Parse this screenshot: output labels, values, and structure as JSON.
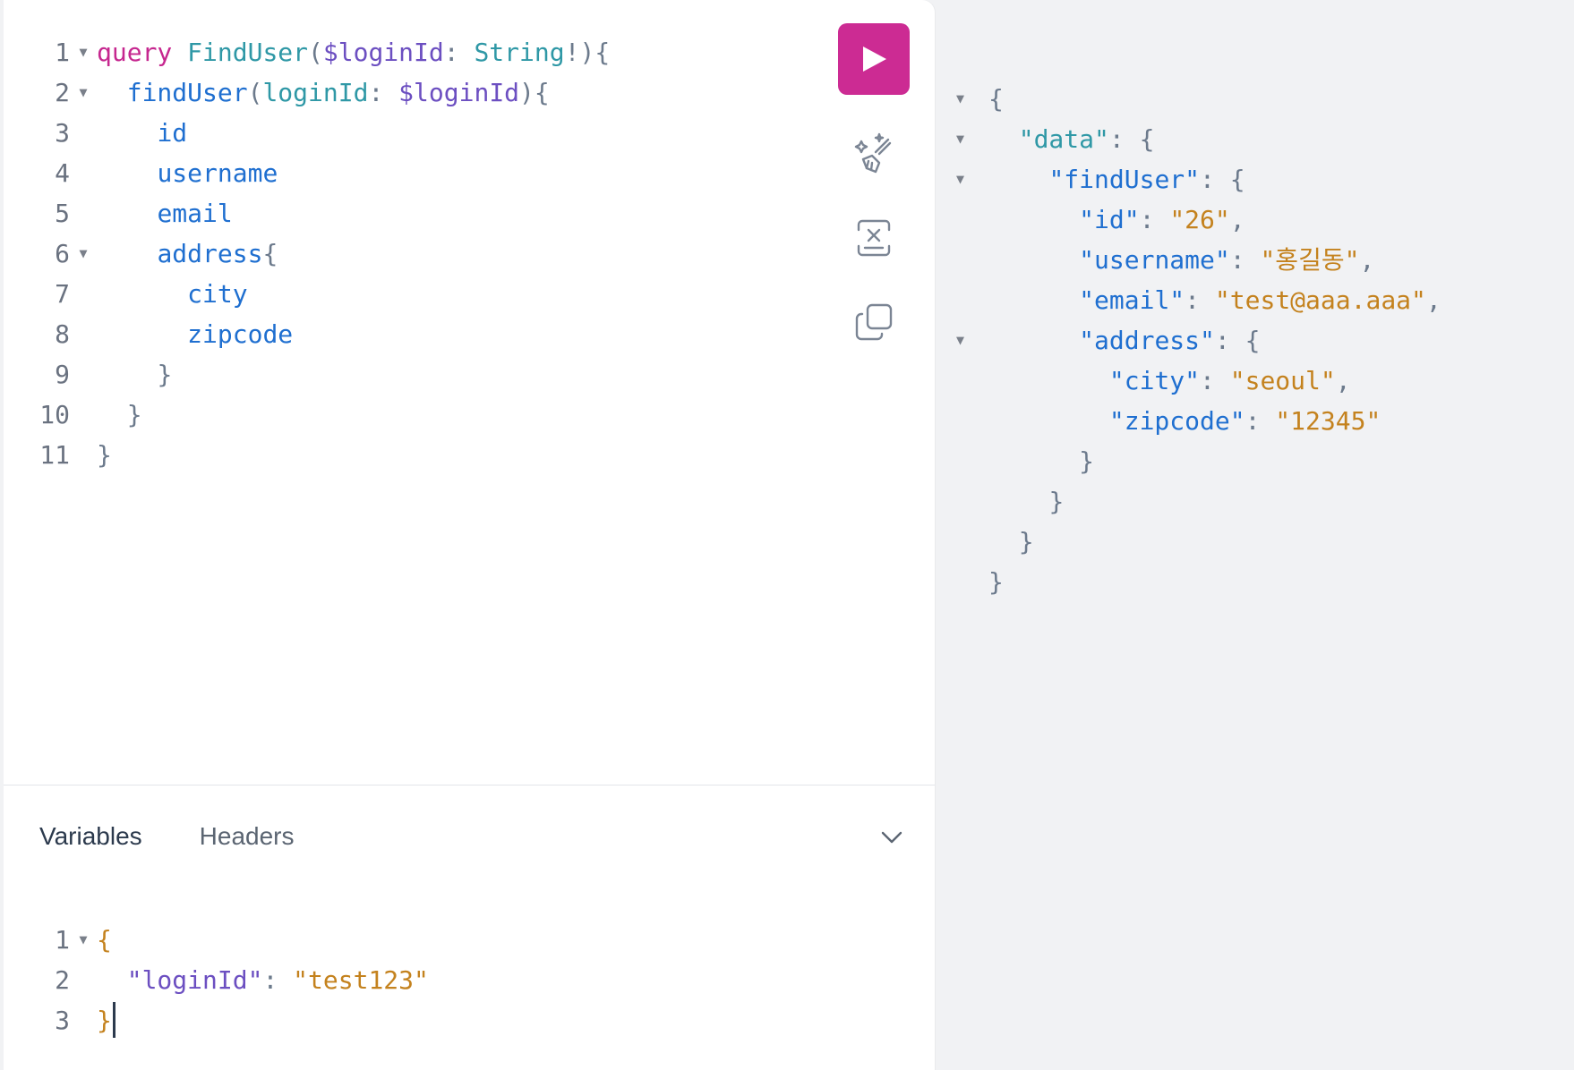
{
  "query_editor": {
    "line_numbers": [
      "1",
      "2",
      "3",
      "4",
      "5",
      "6",
      "7",
      "8",
      "9",
      "10",
      "11"
    ],
    "l1": {
      "keyword": "query",
      "name": "FindUser",
      "open": "(",
      "var": "$loginId",
      "colon": ":",
      "type": "String",
      "bang": "!",
      "close": "){"
    },
    "l2": {
      "field": "findUser",
      "open": "(",
      "arg": "loginId",
      "colon": ":",
      "var": "$loginId",
      "close": "){"
    },
    "l3": {
      "field": "id"
    },
    "l4": {
      "field": "username"
    },
    "l5": {
      "field": "email"
    },
    "l6": {
      "field": "address",
      "brace": "{"
    },
    "l7": {
      "field": "city"
    },
    "l8": {
      "field": "zipcode"
    },
    "l9": {
      "brace": "}"
    },
    "l10": {
      "brace": "}"
    },
    "l11": {
      "brace": "}"
    }
  },
  "toolbar": {
    "run_icon": "play-icon",
    "prettify_icon": "magic-wand-icon",
    "merge_icon": "merge-fragments-icon",
    "copy_icon": "copy-icon"
  },
  "bottom_panel": {
    "tabs": [
      {
        "label": "Variables",
        "active": true
      },
      {
        "label": "Headers",
        "active": false
      }
    ],
    "collapse_icon": "chevron-down-icon",
    "line_numbers": [
      "1",
      "2",
      "3"
    ],
    "v1": {
      "brace": "{"
    },
    "v2": {
      "key": "\"loginId\"",
      "colon": ":",
      "value": "\"test123\""
    },
    "v3": {
      "brace": "}"
    }
  },
  "result": {
    "r1": {
      "brace": "{"
    },
    "r2": {
      "key": "\"data\"",
      "colon": ":",
      "brace": "{"
    },
    "r3": {
      "key": "\"findUser\"",
      "colon": ":",
      "brace": "{"
    },
    "r4": {
      "key": "\"id\"",
      "colon": ":",
      "value": "\"26\"",
      "comma": ","
    },
    "r5": {
      "key": "\"username\"",
      "colon": ":",
      "value": "\"홍길동\"",
      "comma": ","
    },
    "r6": {
      "key": "\"email\"",
      "colon": ":",
      "value": "\"test@aaa.aaa\"",
      "comma": ","
    },
    "r7": {
      "key": "\"address\"",
      "colon": ":",
      "brace": "{"
    },
    "r8": {
      "key": "\"city\"",
      "colon": ":",
      "value": "\"seoul\"",
      "comma": ","
    },
    "r9": {
      "key": "\"zipcode\"",
      "colon": ":",
      "value": "\"12345\""
    },
    "r10": {
      "brace": "}"
    },
    "r11": {
      "brace": "}"
    },
    "r12": {
      "brace": "}"
    },
    "r13": {
      "brace": "}"
    }
  },
  "colors": {
    "run_button": "#cc2b93",
    "keyword": "#c6278f",
    "field": "#1f6fd0",
    "variable": "#6c4fc1",
    "string": "#c4821e"
  }
}
